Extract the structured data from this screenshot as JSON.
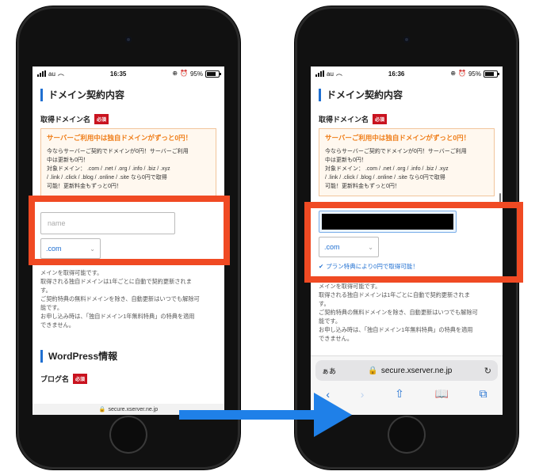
{
  "left": {
    "status": {
      "carrier": "au",
      "time": "16:35",
      "battery": "95%"
    },
    "section_title": "ドメイン契約内容",
    "domain_label": "取得ドメイン名",
    "required": "必須",
    "promo_title": "サーバーご利用中は独自ドメインがずっと0円！",
    "promo_lines": [
      "今ならサーバーご契約でドメインが0円！サーバーご利用",
      "中は更新も0円！",
      "対象ドメイン： .com / .net / .org / .info / .biz / .xyz",
      "/ .link / .click / .blog / .online / .site なら0円で取得",
      "可能！更新料金もずっと0円！"
    ],
    "input_placeholder": "name",
    "select_value": ".com",
    "notes_lines": [
      "メインを取得可能です。",
      "取得される独自ドメインは1年ごとに自動で契約更新されま",
      "す。",
      "ご契約特典の無料ドメインを除き、自動更新はいつでも解除可",
      "能です。",
      "お申し込み時は、「独自ドメイン1年無料特典」の特典を適用",
      "できません。"
    ],
    "section2_title": "WordPress情報",
    "blog_label": "ブログ名",
    "url": "secure.xserver.ne.jp"
  },
  "right": {
    "status": {
      "carrier": "au",
      "time": "16:36",
      "battery": "95%"
    },
    "section_title": "ドメイン契約内容",
    "domain_label": "取得ドメイン名",
    "required": "必須",
    "promo_title": "サーバーご利用中は独自ドメインがずっと0円！",
    "promo_lines": [
      "今ならサーバーご契約でドメインが0円！サーバーご利用",
      "中は更新も0円！",
      "対象ドメイン： .com / .net / .org / .info / .biz / .xyz",
      "/ .link / .click / .blog / .online / .site なら0円で取得",
      "可能！更新料金もずっと0円！"
    ],
    "select_value": ".com",
    "ok_message": "プラン特典により0円で取得可能！",
    "notes_lines": [
      "メインを取得可能です。",
      "取得される独自ドメインは1年ごとに自動で契約更新されま",
      "す。",
      "ご契約特典の無料ドメインを除き、自動更新はいつでも解除可",
      "能です。",
      "お申し込み時は、「独自ドメイン1年無料特典」の特典を適用",
      "できません。"
    ],
    "safari_aa": "ぁあ",
    "url": "secure.xserver.ne.jp"
  },
  "colors": {
    "highlight": "#f04a23",
    "arrow": "#1f80e8",
    "accent": "#1f6fd1",
    "promo_title": "#ef7d18",
    "required_badge": "#c9131f"
  }
}
